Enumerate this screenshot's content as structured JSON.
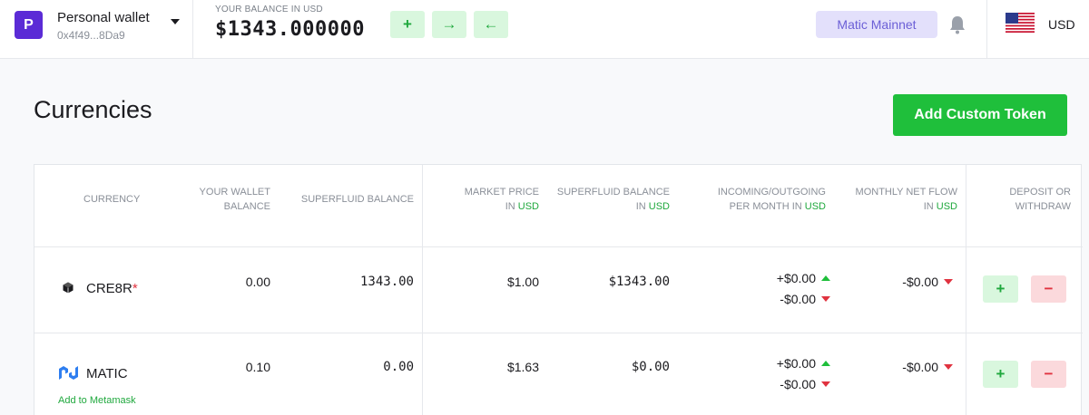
{
  "header": {
    "wallet_initial": "P",
    "wallet_name": "Personal wallet",
    "wallet_address": "0x4f49...8Da9",
    "balance_label": "YOUR BALANCE IN USD",
    "balance_value": "$1343.000000",
    "actions": {
      "add": "+",
      "send": "→",
      "receive": "←"
    },
    "network": "Matic Mainnet",
    "currency": "USD"
  },
  "page": {
    "title": "Currencies",
    "add_token_label": "Add Custom Token"
  },
  "table": {
    "columns": {
      "currency": "CURRENCY",
      "wallet_balance_1": "YOUR WALLET",
      "wallet_balance_2": "BALANCE",
      "superfluid_balance": "SUPERFLUID BALANCE",
      "market_price_1": "MARKET PRICE",
      "market_price_2": "IN ",
      "sf_balance_usd_1": "SUPERFLUID BALANCE",
      "sf_balance_usd_2": "IN ",
      "flow_1": "INCOMING/OUTGOING",
      "flow_2": "PER MONTH IN ",
      "net_flow_1": "MONTHLY NET FLOW",
      "net_flow_2": "IN ",
      "deposit_1": "DEPOSIT OR",
      "deposit_2": "WITHDRAW",
      "usd": "USD"
    },
    "rows": [
      {
        "token": "CRE8R",
        "asterisk": "*",
        "wallet_balance": "0.00",
        "superfluid_balance": "1343.00",
        "market_price": "$1.00",
        "sf_balance_usd": "$1343.00",
        "incoming": "+$0.00",
        "outgoing": "-$0.00",
        "net_flow": "-$0.00",
        "plus": "+",
        "minus": "−"
      },
      {
        "token": "MATIC",
        "metamask_link": "Add to Metamask",
        "wallet_balance": "0.10",
        "superfluid_balance": "0.00",
        "market_price": "$1.63",
        "sf_balance_usd": "$0.00",
        "incoming": "+$0.00",
        "outgoing": "-$0.00",
        "net_flow": "-$0.00",
        "plus": "+",
        "minus": "−"
      }
    ]
  }
}
